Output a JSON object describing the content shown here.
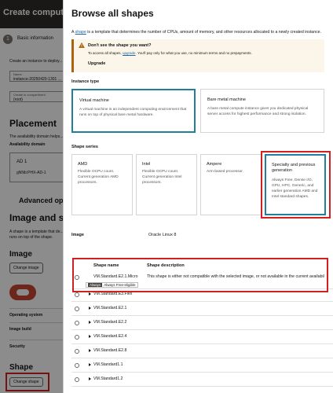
{
  "background": {
    "title": "Create compute",
    "step": {
      "number": "1",
      "label": "Basic information"
    },
    "intro": "Create an instance to deploy...",
    "name_field": {
      "label": "Name",
      "value": "instance-20250420-1301 ..."
    },
    "compartment_field": {
      "label": "Create in compartment",
      "value": "(root)"
    },
    "placement_heading": "Placement",
    "placement_text": "The availability domain helps...",
    "ad_label": "Availability domain",
    "ad_card": {
      "title": "AD 1",
      "subtitle": "gNNb:PHX-AD-1"
    },
    "advanced_label": "Advanced opti",
    "image_shape_heading": "Image and sha",
    "image_shape_text_1": "A shape is a template that de...",
    "image_shape_text_2": "runs on top of the shape.",
    "image_heading": "Image",
    "change_image_button": "Change image",
    "os_label": "Operating system",
    "image_build_label": "Image build",
    "security_label": "Security",
    "shape_heading": "Shape",
    "change_shape_button": "Change shape"
  },
  "panel": {
    "title": "Browse all shapes",
    "intro_prefix": "A",
    "intro_link": "shape",
    "intro_rest": "is a template that determines the number of CPUs, amount of memory, and other resources allocated to a newly created instance.",
    "notice": {
      "title": "Don't see the shape you want?",
      "body_prefix": "To access all shapes,",
      "body_link": "upgrade",
      "body_rest": ". You'll pay only for what you use, no minimum terms and no prepayments.",
      "action": "Upgrade"
    },
    "instance_type_label": "Instance type",
    "instance_types": [
      {
        "title": "Virtual machine",
        "desc": "A virtual machine is an independent computing environment that runs on top of physical bare metal hardware.",
        "selected": true
      },
      {
        "title": "Bare metal machine",
        "desc": "A bare metal compute instance gives you dedicated physical server access for highest performance and strong isolation.",
        "selected": false
      }
    ],
    "shape_series_label": "Shape series",
    "shape_series": [
      {
        "title": "AMD",
        "desc": "Flexible OCPU count. Current generation AMD processors.",
        "selected": false
      },
      {
        "title": "Intel",
        "desc": "Flexible OCPU count. Current generation Intel processors.",
        "selected": false
      },
      {
        "title": "Ampere",
        "desc": "Arm-based processor.",
        "selected": false
      },
      {
        "title": "Specialty and previous generation",
        "desc": "Always Free, Dense I/O, GPU, HPC, Generic, and earlier generation AMD and Intel standard shapes.",
        "selected": true
      }
    ],
    "image_row": {
      "label": "Image",
      "value": "Oracle Linux 8"
    },
    "table": {
      "col_name": "Shape name",
      "col_desc": "Shape description",
      "rows": [
        {
          "name": "VM.Standard.E2.1.Micro",
          "desc": "This shape is either not compatible with the selected image, or not available in the current availabil",
          "badge_tip": "Always",
          "badge": "Always Free-eligible"
        },
        {
          "name": "VM.Standard.E3.Flex",
          "desc": ""
        },
        {
          "name": "VM.Standard.E2.1",
          "desc": ""
        },
        {
          "name": "VM.Standard.E2.2",
          "desc": ""
        },
        {
          "name": "VM.Standard.E2.4",
          "desc": ""
        },
        {
          "name": "VM.Standard.E2.8",
          "desc": ""
        },
        {
          "name": "VM.Standard1.1",
          "desc": ""
        },
        {
          "name": "VM.Standard1.2",
          "desc": ""
        }
      ]
    }
  },
  "colors": {
    "accent": "#227e9e",
    "highlight": "#d41f1f",
    "header": "#312d2a",
    "warning": "#ac630c",
    "link": "#1a66a6"
  }
}
